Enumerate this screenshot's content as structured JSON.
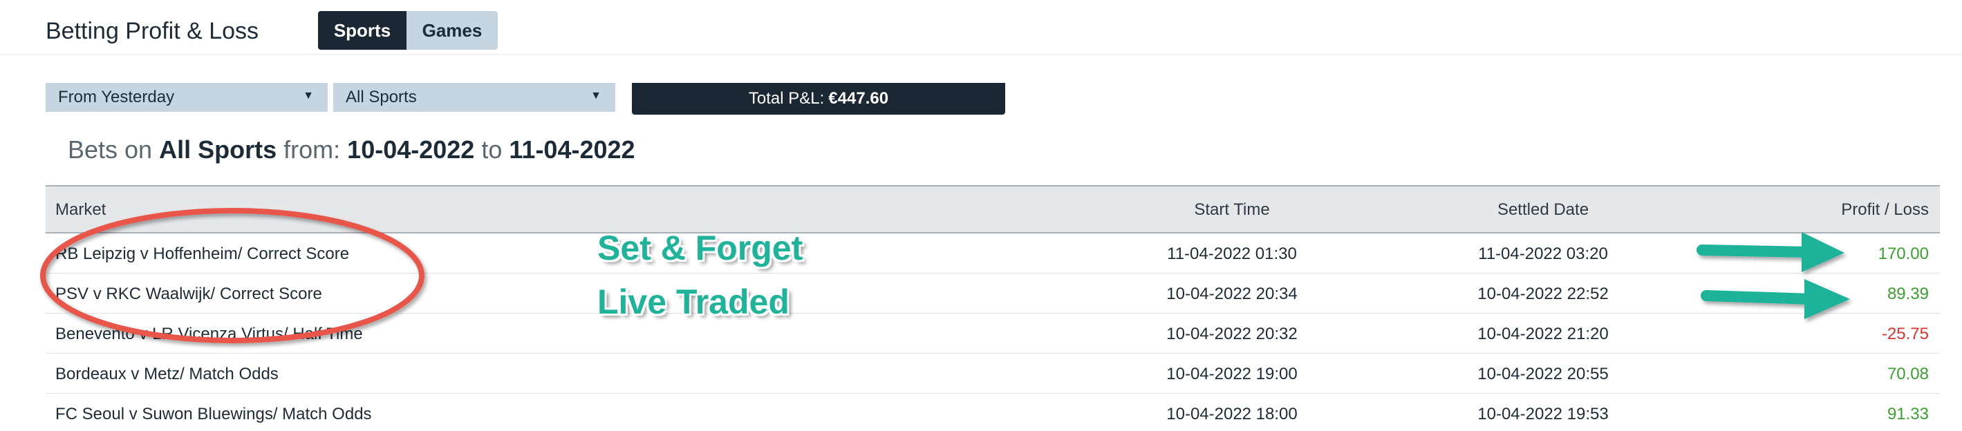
{
  "header": {
    "title": "Betting Profit & Loss",
    "tabs": [
      {
        "label": "Sports",
        "active": true
      },
      {
        "label": "Games",
        "active": false
      }
    ]
  },
  "filters": {
    "period": "From Yesterday",
    "sport": "All Sports"
  },
  "total": {
    "label": "Total P&L:",
    "value": "€447.60"
  },
  "bets_heading": {
    "prefix": "Bets on",
    "sport": "All Sports",
    "from_label": "from:",
    "from_date": "10-04-2022",
    "to_label": "to",
    "to_date": "11-04-2022"
  },
  "table": {
    "columns": [
      "Market",
      "Start Time",
      "Settled Date",
      "Profit / Loss"
    ],
    "rows": [
      {
        "market": "RB Leipzig v Hoffenheim/ Correct Score",
        "start": "11-04-2022 01:30",
        "settled": "11-04-2022 03:20",
        "pl": "170.00",
        "sign": "pos"
      },
      {
        "market": "PSV v RKC Waalwijk/ Correct Score",
        "start": "10-04-2022 20:34",
        "settled": "10-04-2022 22:52",
        "pl": "89.39",
        "sign": "pos"
      },
      {
        "market": "Benevento v LR Vicenza Virtus/ Half Time",
        "start": "10-04-2022 20:32",
        "settled": "10-04-2022 21:20",
        "pl": "-25.75",
        "sign": "neg"
      },
      {
        "market": "Bordeaux v Metz/ Match Odds",
        "start": "10-04-2022 19:00",
        "settled": "10-04-2022 20:55",
        "pl": "70.08",
        "sign": "pos"
      },
      {
        "market": "FC Seoul v Suwon Bluewings/ Match Odds",
        "start": "10-04-2022 18:00",
        "settled": "10-04-2022 19:53",
        "pl": "91.33",
        "sign": "pos"
      }
    ]
  },
  "annotations": {
    "label_1": "Set & Forget",
    "label_2": "Live Traded",
    "colors": {
      "text": "#1fb39a",
      "arrow": "#1fb39a",
      "ellipse": "#e8574a"
    }
  }
}
